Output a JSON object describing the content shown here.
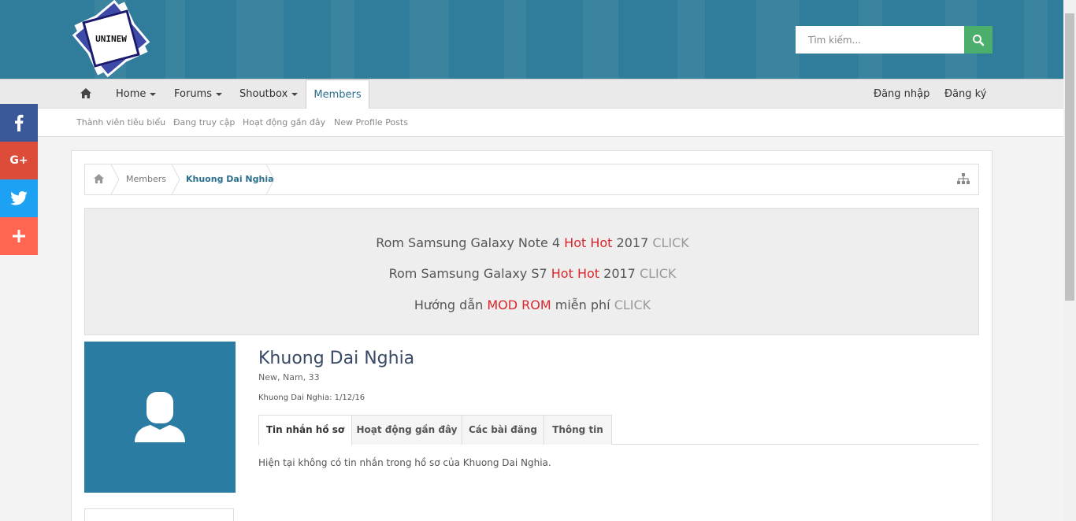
{
  "header": {
    "logo_text": "UNINEW",
    "search_placeholder": "Tìm kiếm..."
  },
  "nav": {
    "items": [
      {
        "label": "Home",
        "dropdown": true
      },
      {
        "label": "Forums",
        "dropdown": true
      },
      {
        "label": "Shoutbox",
        "dropdown": true
      },
      {
        "label": "Members",
        "active": true
      }
    ],
    "login": "Đăng nhập",
    "register": "Đăng ký"
  },
  "subnav": {
    "items": [
      "Thành viên tiêu biểu",
      "Đang truy cập",
      "Hoạt động gần đây",
      "New Profile Posts"
    ]
  },
  "social": [
    {
      "name": "facebook",
      "color": "#3b5998",
      "glyph": "f"
    },
    {
      "name": "google-plus",
      "color": "#dd4b39",
      "glyph": "G+"
    },
    {
      "name": "twitter",
      "color": "#1da1f2",
      "glyph": "twitter"
    },
    {
      "name": "share-more",
      "color": "#ff6550",
      "glyph": "+"
    }
  ],
  "breadcrumb": {
    "items": [
      "Members",
      "Khuong Dai Nghia"
    ]
  },
  "promo": {
    "line1": {
      "a": "Rom Samsung Galaxy Note 4 ",
      "hot": "Hot Hot",
      "b": " 2017 ",
      "click": "CLICK"
    },
    "line2": {
      "a": "Rom Samsung Galaxy S7 ",
      "hot": "Hot Hot",
      "b": " 2017 ",
      "click": "CLICK"
    },
    "line3": {
      "a": "Hướng dẫn ",
      "hot": "MOD ROM",
      "b": " miễn phí ",
      "click": "CLICK"
    }
  },
  "profile": {
    "name": "Khuong Dai Nghia",
    "meta": "New, Nam, 33",
    "date_line": "Khuong Dai Nghia: 1/12/16",
    "tabs": [
      "Tin nhắn hồ sơ",
      "Hoạt động gần đây",
      "Các bài đăng",
      "Thông tin"
    ],
    "empty_message": "Hiện tại không có tin nhắn trong hồ sơ của Khuong Dai Nghia."
  },
  "colors": {
    "header_bg": "#2f7d9b",
    "search_button": "#4cae6c",
    "link_blue": "#2b6f8e",
    "hot_red": "#d9262b",
    "avatar_bg": "#2a7ca3"
  }
}
